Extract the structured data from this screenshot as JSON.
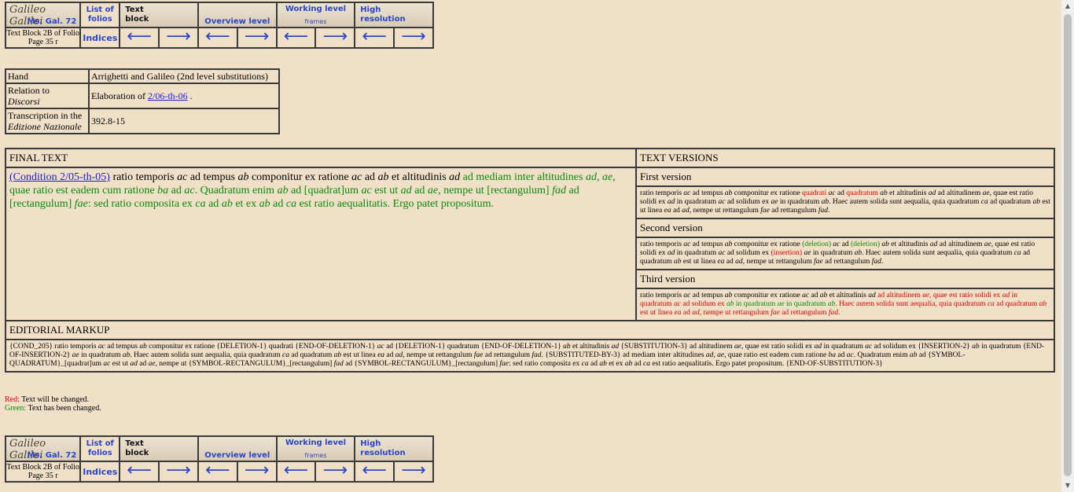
{
  "nav": {
    "logo_line1": "Galileo Galilei",
    "logo_line2": "Ms. Gal. 72",
    "list_of_folios": "List of folios",
    "text_block": "Text block",
    "overview_level": "Overview level",
    "working_level": "Working level",
    "frames": "frames",
    "high_resolution": "High resolution",
    "block_info": "Text Block 2B of Folio Page 35 r",
    "indices": "Indices",
    "arrow_left": "⟵",
    "arrow_right": "⟶"
  },
  "info": {
    "hand_label": "Hand",
    "hand_value": "Arrighetti and Galileo (2nd level substitutions)",
    "relation_label_1": "Relation to",
    "relation_label_2": "Discorsi",
    "relation_value": "Elaboration of ",
    "relation_link": "2/06-th-06",
    "relation_end": " .",
    "transcription_label_1": "Transcription in the",
    "transcription_label_2": "Edizione Nazionale",
    "transcription_value": "392.8-15"
  },
  "main": {
    "final_text_header": "FINAL TEXT",
    "versions_header": "TEXT VERSIONS",
    "first_version": "First version",
    "second_version": "Second version",
    "third_version": "Third version",
    "editorial_header": "EDITORIAL MARKUP",
    "final_link": "(Condition 2/05-th-05)"
  },
  "legend": {
    "red_label": "Red:",
    "red_text": " Text will be changed.",
    "green_label": "Green:",
    "green_text": " Text has been changed."
  },
  "colors": {
    "background": "#f0e0c8",
    "link": "#1a1ae0",
    "red": "#e00000",
    "green": "#0a8a0a",
    "nav_blue": "#2a45c8"
  }
}
